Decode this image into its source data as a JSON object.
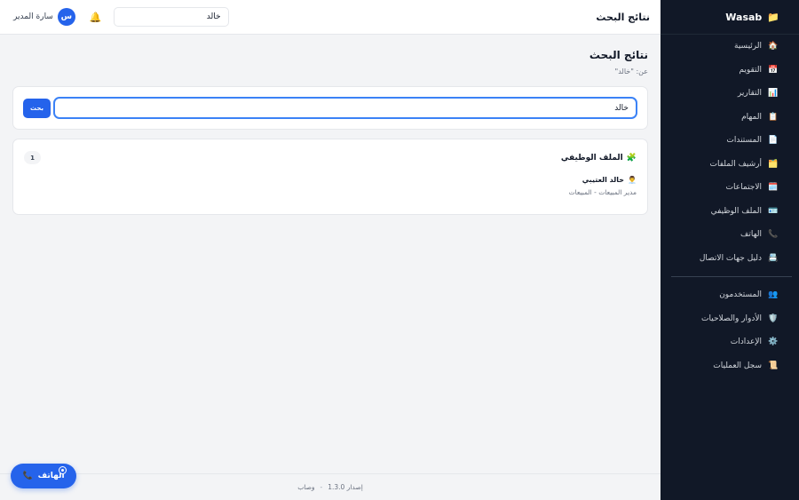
{
  "brand": {
    "name": "Wasab",
    "icon": "📁"
  },
  "nav_primary": [
    {
      "label": "الرئيسية",
      "icon": "🏠"
    },
    {
      "label": "التقويم",
      "icon": "📅"
    },
    {
      "label": "التقارير",
      "icon": "📊"
    },
    {
      "label": "المهام",
      "icon": "📋"
    },
    {
      "label": "المستندات",
      "icon": "📄"
    },
    {
      "label": "أرشيف الملفات",
      "icon": "🗂️"
    },
    {
      "label": "الاجتماعات",
      "icon": "🗓️"
    },
    {
      "label": "الملف الوظيفي",
      "icon": "🪪"
    },
    {
      "label": "الهاتف",
      "icon": "📞"
    },
    {
      "label": "دليل جهات الاتصال",
      "icon": "📇"
    }
  ],
  "nav_secondary": [
    {
      "label": "المستخدمون",
      "icon": "👥"
    },
    {
      "label": "الأدوار والصلاحيات",
      "icon": "🛡️"
    },
    {
      "label": "الإعدادات",
      "icon": "⚙️"
    },
    {
      "label": "سجل العمليات",
      "icon": "📜"
    }
  ],
  "topbar": {
    "title": "نتائج البحث",
    "search_value": "خالد",
    "bell_icon": "🔔",
    "user_name": "سارة المدير",
    "avatar_initial": "س"
  },
  "page": {
    "title": "نتائج البحث",
    "subtitle": "عن: \"خالد\""
  },
  "search": {
    "value": "خالد",
    "button_label": "بحث"
  },
  "results": {
    "section_icon": "🧩",
    "section_title": "الملف الوظيفي",
    "count": "1",
    "items": [
      {
        "icon": "👨‍💼",
        "name": "خالد العتيبي",
        "meta": "مدير المبيعات - المبيعات"
      }
    ]
  },
  "footer": {
    "version": "إصدار 1.3.0",
    "separator": "-",
    "name": "وصاب"
  },
  "fab": {
    "label": "الهاتف",
    "icon": "📞"
  },
  "colors": {
    "sidebar_bg": "#111827",
    "accent": "#2563eb"
  }
}
